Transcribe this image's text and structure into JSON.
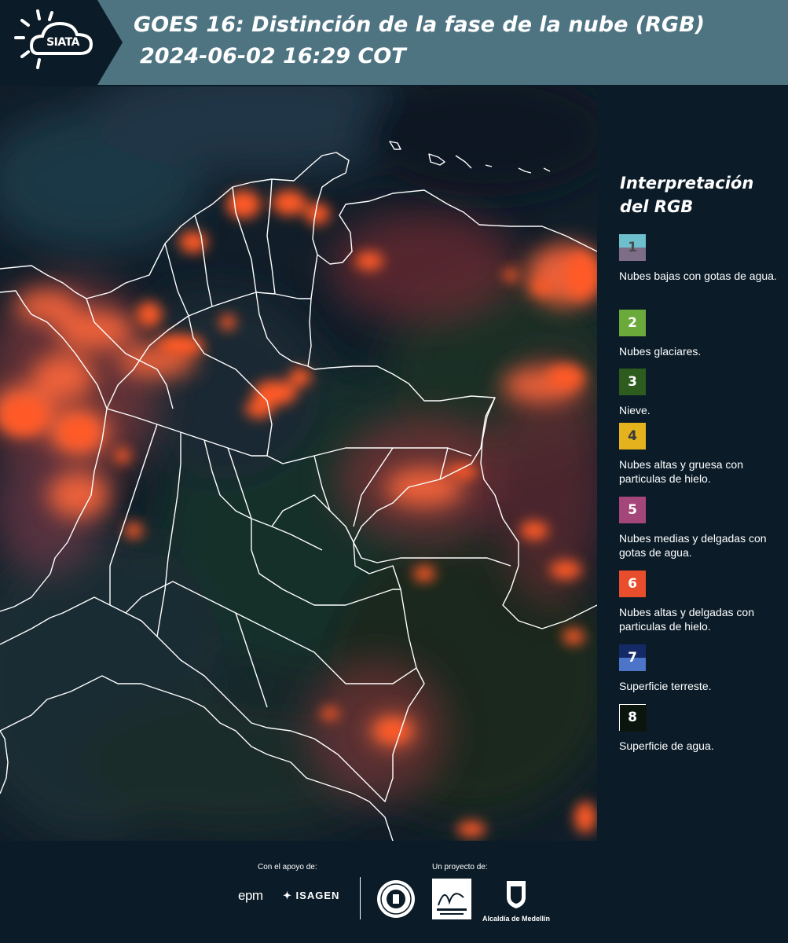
{
  "header": {
    "logo_text": "SIATA",
    "title_line1": "GOES 16: Distinción de la fase de la nube (RGB)",
    "title_line2": "2024-06-02 16:29 COT"
  },
  "legend": {
    "title": "Interpretación\ndel RGB",
    "items": [
      {
        "number": "1",
        "label": "Nubes bajas con gotas de agua.",
        "color_top": "#6dbfce",
        "color_bottom": "#7d6d86",
        "num_color": "#4a4a4a"
      },
      {
        "number": "2",
        "label": "Nubes glaciares.",
        "color_top": "#6aa93a",
        "color_bottom": "#6aa93a",
        "num_color": "#ffffff"
      },
      {
        "number": "3",
        "label": "Nieve.",
        "color_top": "#2e5c1e",
        "color_bottom": "#2e5c1e",
        "num_color": "#ffffff"
      },
      {
        "number": "4",
        "label": "Nubes altas y gruesa con particulas de hielo.",
        "color_top": "#e3b21d",
        "color_bottom": "#e3b21d",
        "num_color": "#3a3a3a"
      },
      {
        "number": "5",
        "label": "Nubes medias y delgadas con gotas de agua.",
        "color_top": "#a5467a",
        "color_bottom": "#a5467a",
        "num_color": "#ffffff"
      },
      {
        "number": "6",
        "label": "Nubes altas y delgadas con particulas de hielo.",
        "color_top": "#e84e2c",
        "color_bottom": "#e84e2c",
        "num_color": "#ffffff"
      },
      {
        "number": "7",
        "label": "Superficie terreste.",
        "color_top": "#132a66",
        "color_bottom": "#4c74c8",
        "num_color": "#ffffff"
      },
      {
        "number": "8",
        "label": "Superficie de agua.",
        "color_top": "#0a150e",
        "color_bottom": "#0a150e",
        "num_color": "#ffffff",
        "border": "#ffffff"
      }
    ]
  },
  "footer": {
    "support_caption": "Con el apoyo de:",
    "project_caption": "Un proyecto de:",
    "epm_logo_text": "epm",
    "isagen_logo_text": "ISAGEN",
    "alcaldia_text": "Alcaldía de Medellín"
  },
  "colors": {
    "header_bg": "#4e7482",
    "page_bg": "#0b1c28",
    "cloud_high": "#ff5a28",
    "cloud_mid": "#f7845a",
    "border_line": "#ffffff"
  }
}
